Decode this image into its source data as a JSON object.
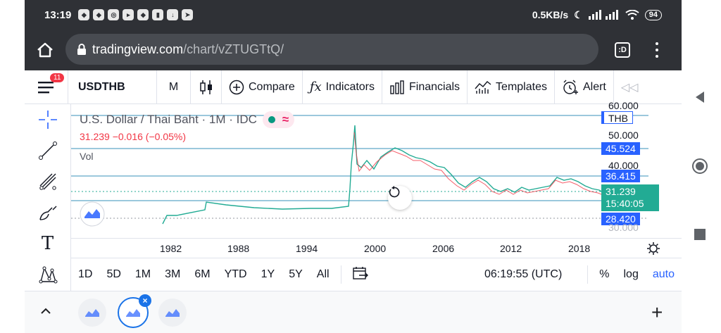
{
  "status_bar": {
    "time": "13:19",
    "net_speed": "0.5KB/s",
    "battery": "94"
  },
  "browser": {
    "url_domain": "tradingview.com",
    "url_path": "/chart/vZTUGTtQ/",
    "tabs_label": ":D"
  },
  "toolbar": {
    "badge": "11",
    "symbol": "USDTHB",
    "interval": "M",
    "compare": "Compare",
    "indicators": "Indicators",
    "financials": "Financials",
    "templates": "Templates",
    "alert": "Alert"
  },
  "legend": {
    "title": "U.S. Dollar / Thai Baht · 1M · IDC",
    "quote": "31.239  −0.016 (−0.05%)",
    "vol": "Vol"
  },
  "price_axis": {
    "ticks": [
      "60.000",
      "50.000",
      "40.000",
      "30.000"
    ],
    "currency": "THB",
    "labels": [
      "45.524",
      "36.415",
      "28.420"
    ],
    "current_price": "31.239",
    "countdown": "15:40:05"
  },
  "time_axis": [
    "1982",
    "1988",
    "1994",
    "2000",
    "2006",
    "2012",
    "2018"
  ],
  "range_bar": {
    "ranges": [
      "1D",
      "5D",
      "1M",
      "3M",
      "6M",
      "YTD",
      "1Y",
      "5Y",
      "All"
    ],
    "clock": "06:19:55 (UTC)",
    "percent": "%",
    "log": "log",
    "auto": "auto"
  },
  "colors": {
    "accent": "#2962ff",
    "up": "#22ab94",
    "down": "#f23645",
    "status_bg": "#2f3136"
  }
}
